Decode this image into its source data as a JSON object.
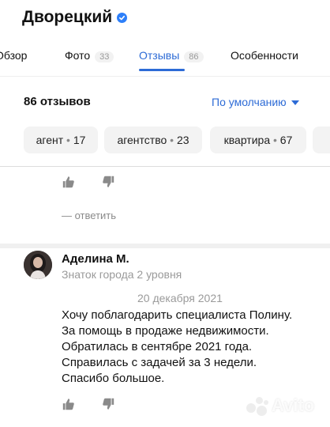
{
  "header": {
    "title": "Дворецкий"
  },
  "tabs": [
    {
      "label": "Обзор",
      "count": ""
    },
    {
      "label": "Фото",
      "count": "33"
    },
    {
      "label": "Отзывы",
      "count": "86"
    },
    {
      "label": "Особенности",
      "count": ""
    }
  ],
  "reviews_summary": {
    "count_label": "86 отзывов",
    "sort_label": "По умолчанию"
  },
  "chips": [
    {
      "label": "агент",
      "count": "17"
    },
    {
      "label": "агентство",
      "count": "23"
    },
    {
      "label": "квартира",
      "count": "67"
    }
  ],
  "chip_dot": "•",
  "reply_label": "— ответить",
  "review": {
    "author": "Аделина М.",
    "level": "Знаток города 2 уровня",
    "date": "20 декабря 2021",
    "text": "Хочу поблагодарить специалиста Полину. За помощь в продаже недвижимости. Обратилась в сентябре 2021 года. Справилась с задачей за 3 недели. Спасибо большое."
  },
  "watermark": "Avito",
  "colors": {
    "accent": "#2d6bd6",
    "verified": "#2d7ff9",
    "muted": "#9a9a9a",
    "chip_bg": "#f3f3f3"
  }
}
